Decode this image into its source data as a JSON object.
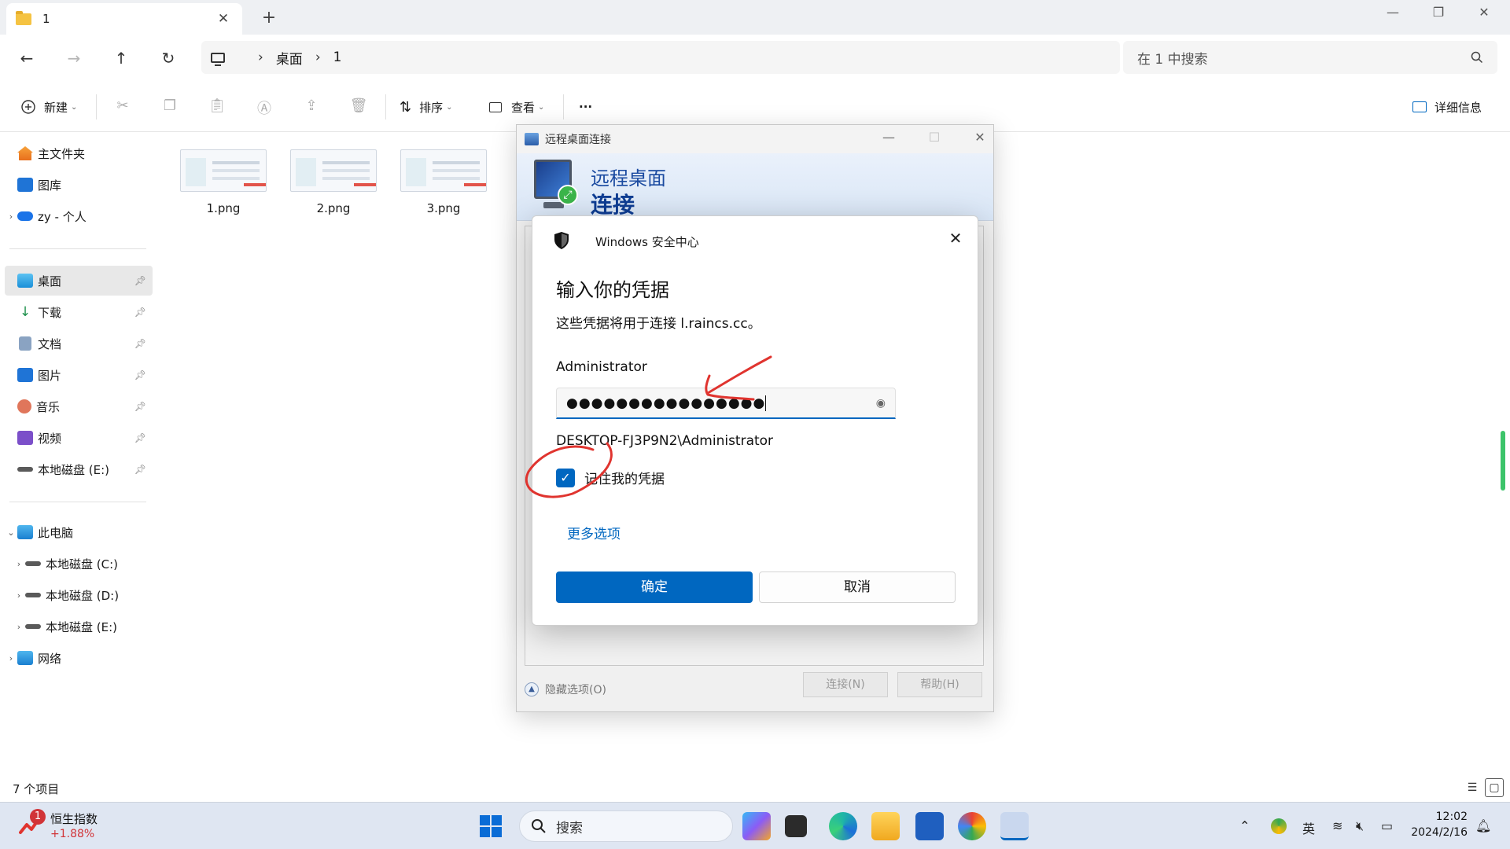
{
  "explorer": {
    "tab_title": "1",
    "new_tab": "+",
    "window_controls": {
      "minimize": "—",
      "restore": "❐",
      "close": "✕"
    },
    "address": {
      "segments": [
        "桌面",
        "1"
      ],
      "separator": "›"
    },
    "search_placeholder": "在 1 中搜索",
    "toolbar": {
      "new_label": "新建",
      "sort_label": "排序",
      "view_label": "查看",
      "more_label": "···",
      "details_label": "详细信息"
    },
    "sidebar": {
      "items": [
        {
          "label": "主文件夹"
        },
        {
          "label": "图库"
        },
        {
          "label": "zy - 个人"
        },
        {
          "label": "桌面"
        },
        {
          "label": "下载"
        },
        {
          "label": "文档"
        },
        {
          "label": "图片"
        },
        {
          "label": "音乐"
        },
        {
          "label": "视频"
        },
        {
          "label": "本地磁盘 (E:)"
        },
        {
          "label": "此电脑"
        },
        {
          "label": "本地磁盘 (C:)"
        },
        {
          "label": "本地磁盘 (D:)"
        },
        {
          "label": "本地磁盘 (E:)"
        },
        {
          "label": "网络"
        }
      ]
    },
    "files": [
      {
        "name": "1.png"
      },
      {
        "name": "2.png"
      },
      {
        "name": "3.png"
      }
    ],
    "status": "7 个项目"
  },
  "rdp": {
    "window_title": "远程桌面连接",
    "banner_line1": "远程桌面",
    "banner_line2": "连接",
    "hide_options": "隐藏选项(O)",
    "connect_button": "连接(N)",
    "help_button": "帮助(H)"
  },
  "security": {
    "header": "Windows 安全中心",
    "title": "输入你的凭据",
    "description": "这些凭据将用于连接 l.raincs.cc。",
    "username": "Administrator",
    "password_mask": "●●●●●●●●●●●●●●●●",
    "domain_user": "DESKTOP-FJ3P9N2\\Administrator",
    "remember_label": "记住我的凭据",
    "remember_checked": true,
    "more_options": "更多选项",
    "ok_button": "确定",
    "cancel_button": "取消"
  },
  "taskbar": {
    "stock_badge": "1",
    "stock_name": "恒生指数",
    "stock_change": "+1.88%",
    "search_placeholder": "搜索",
    "ime": "英",
    "time": "12:02",
    "date": "2024/2/16"
  },
  "colors": {
    "accent": "#0067c0",
    "annotation_red": "#e0342f",
    "stock_red": "#d13438"
  }
}
